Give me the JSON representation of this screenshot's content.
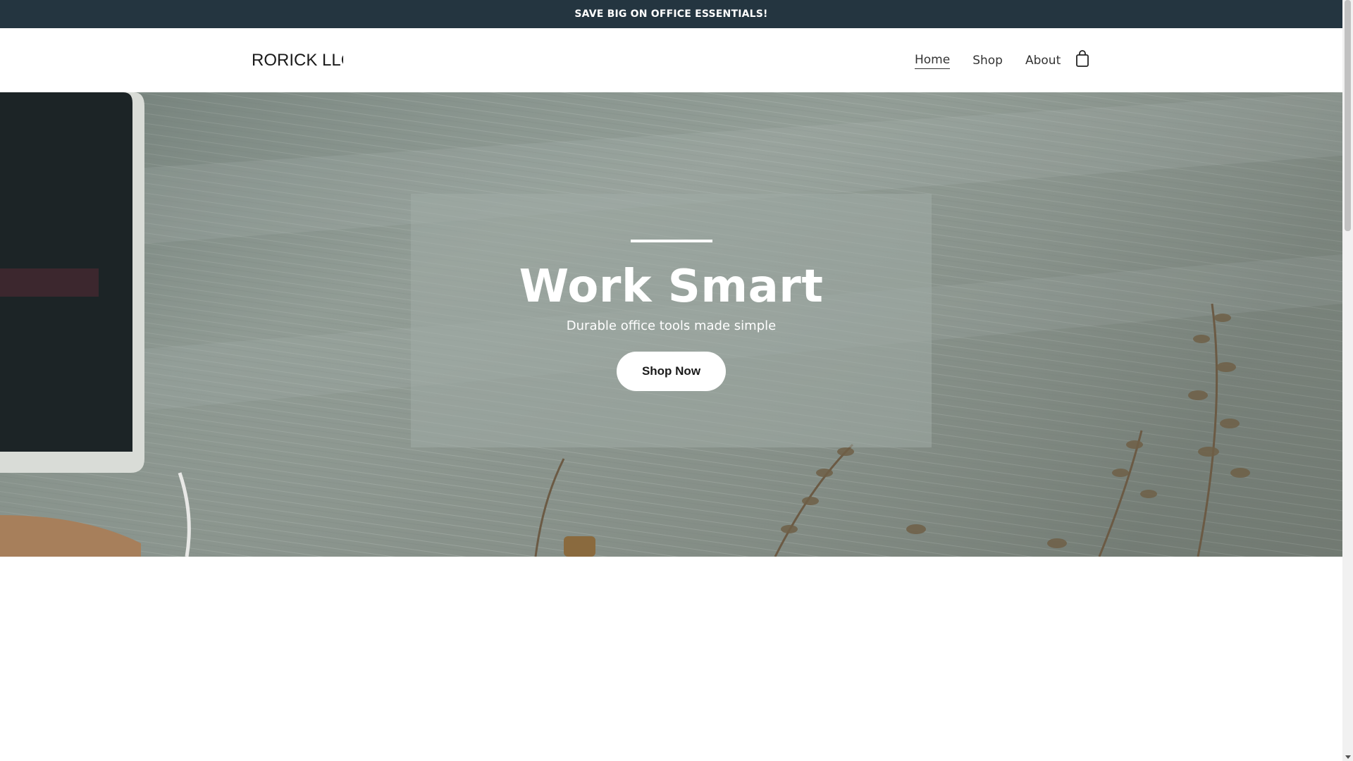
{
  "announcement": {
    "text": "SAVE BIG ON OFFICE ESSENTIALS!"
  },
  "header": {
    "logo": "RORICK LLC",
    "nav": [
      {
        "label": "Home",
        "active": true
      },
      {
        "label": "Shop",
        "active": false
      },
      {
        "label": "About",
        "active": false
      }
    ],
    "cart_icon": "shopping-bag-icon"
  },
  "hero": {
    "title": "Work Smart",
    "subtitle": "Durable office tools made simple",
    "button_label": "Shop Now"
  },
  "colors": {
    "announcement_bg": "#243540",
    "hero_tint": "#8c968f",
    "button_bg": "#ffffff"
  }
}
